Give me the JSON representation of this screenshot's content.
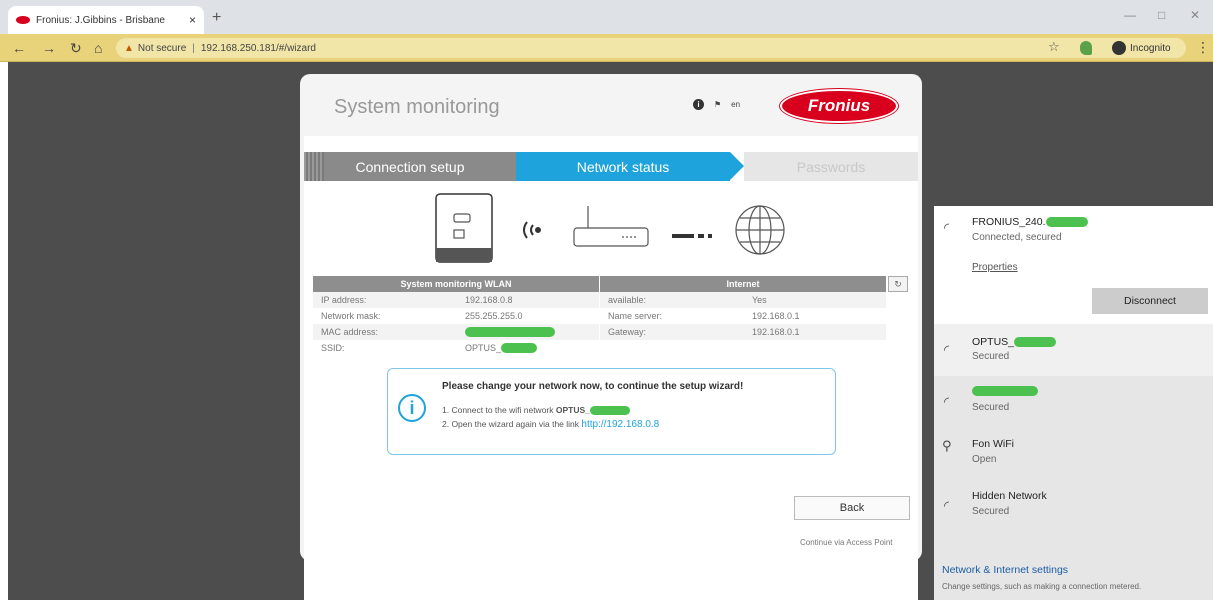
{
  "browser": {
    "tab_title": "Fronius: J.Gibbins - Brisbane",
    "tab_close": "×",
    "new_tab": "+",
    "security_label": "Not secure",
    "url": "192.168.250.181/#/wizard",
    "incognito_label": "Incognito",
    "win_min": "—",
    "win_restore": "□",
    "win_close": "✕"
  },
  "dialog": {
    "title": "System monitoring",
    "language": "en",
    "logo_text": "Fronius",
    "steps": [
      "Connection setup",
      "Network status",
      "Passwords"
    ],
    "wlan_table": {
      "header": "System monitoring WLAN",
      "rows": [
        {
          "key": "IP address:",
          "value": "192.168.0.8"
        },
        {
          "key": "Network mask:",
          "value": "255.255.255.0"
        },
        {
          "key": "MAC address:",
          "value": ""
        },
        {
          "key": "SSID:",
          "value": "OPTUS_"
        }
      ]
    },
    "internet_table": {
      "header": "Internet",
      "rows": [
        {
          "key": "available:",
          "value": "Yes"
        },
        {
          "key": "Name server:",
          "value": "192.168.0.1"
        },
        {
          "key": "Gateway:",
          "value": "192.168.0.1"
        },
        {
          "key": "",
          "value": ""
        }
      ]
    },
    "notice": {
      "title": "Please change your network now, to continue the setup wizard!",
      "line1_prefix": "1. Connect to the wifi network ",
      "line1_network": "OPTUS_",
      "line2_prefix": "2. Open the wizard again via the link ",
      "line2_link": "http://192.168.0.8"
    },
    "back_label": "Back",
    "continue_label": "Continue via Access Point"
  },
  "wifi_panel": {
    "networks": [
      {
        "name": "FRONIUS_240.",
        "status": "Connected, secured"
      },
      {
        "name": "OPTUS_",
        "status": "Secured"
      },
      {
        "name": "",
        "status": "Secured"
      },
      {
        "name": "Fon WiFi",
        "status": "Open"
      },
      {
        "name": "Hidden Network",
        "status": "Secured"
      }
    ],
    "properties_label": "Properties",
    "disconnect_label": "Disconnect",
    "settings_title": "Network & Internet settings",
    "settings_desc": "Change settings, such as making a connection metered."
  },
  "colors": {
    "accent_blue": "#1ea3dd",
    "fronius_red": "#d8001c",
    "redaction_green": "#4cc14f",
    "incognito_bar": "#e8d27a"
  }
}
